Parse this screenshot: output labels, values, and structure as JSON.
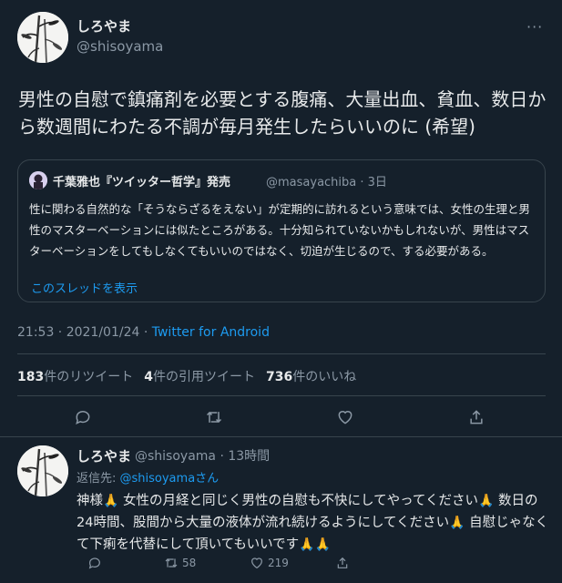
{
  "tweet": {
    "display_name": "しろやま",
    "handle": "@shisoyama",
    "more_label": "···",
    "text": "男性の自慰で鎮痛剤を必要とする腹痛、大量出血、貧血、数日から数週間にわたる不調が毎月発生したらいいのに (希望)",
    "quote": {
      "display_name": "千葉雅也『ツイッター哲学』発売",
      "handle_time": "@masayachiba · 3日",
      "text": "性に関わる自然的な「そうならざるをえない」が定期的に訪れるという意味では、女性の生理と男性のマスターベーションには似たところがある。十分知られていないかもしれないが、男性はマスターベーションをしてもしなくてもいいのではなく、切迫が生じるので、する必要がある。",
      "show_thread": "このスレッドを表示"
    },
    "timestamp": "21:53 · 2021/01/24 · ",
    "source": "Twitter for Android",
    "stats": {
      "retweets_count": "183",
      "retweets_label": "件のリツイート",
      "quotes_count": "4",
      "quotes_label": "件の引用ツイート",
      "likes_count": "736",
      "likes_label": "件のいいね"
    }
  },
  "reply": {
    "display_name": "しろやま",
    "handle_time": "@shisoyama · 13時間",
    "replying_label": "返信先: ",
    "replying_to": "@shisoyama",
    "replying_suffix": "さん",
    "text_parts": [
      "神様",
      " 女性の月経と同じく男性の自慰も不快にしてやってください",
      " 数日の24時間、股間から大量の液体が流れ続けるようにしてください",
      " 自慰じゃなくて下痢を代替にして頂いてもいいです"
    ],
    "emoji": "🙏",
    "retweets": "58",
    "likes": "219"
  },
  "colors": {
    "background": "#15202b",
    "link": "#1d9bf0",
    "muted": "#8b98a5",
    "border": "#38444d"
  }
}
